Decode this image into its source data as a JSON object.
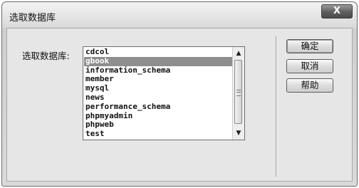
{
  "window": {
    "title": "选取数据库",
    "close_symbol": "X"
  },
  "form": {
    "db_label": "选取数据库:"
  },
  "databases": [
    "cdcol",
    "gbook",
    "information_schema",
    "member",
    "mysql",
    "news",
    "performance_schema",
    "phpmyadmin",
    "phpweb",
    "test"
  ],
  "selected_index": 1,
  "scrollbar": {
    "up_glyph": "▲",
    "down_glyph": "▼"
  },
  "buttons": {
    "ok": "确定",
    "cancel": "取消",
    "help": "帮助"
  }
}
